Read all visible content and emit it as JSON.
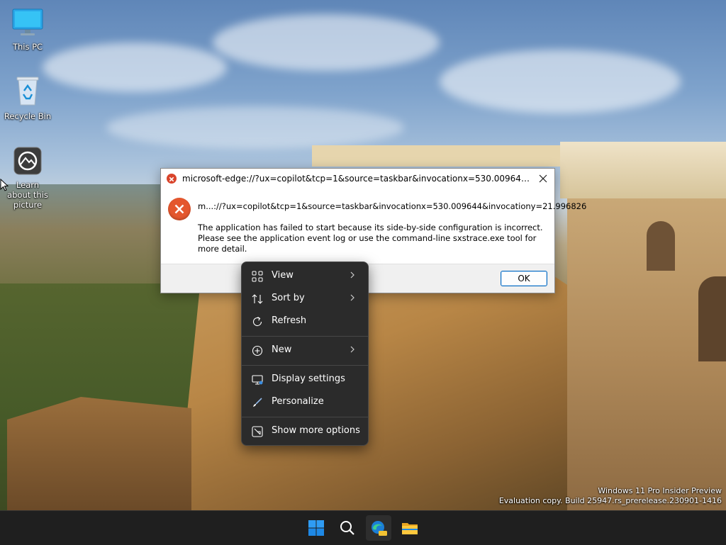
{
  "desktop": {
    "icons": [
      {
        "label": "This PC"
      },
      {
        "label": "Recycle Bin"
      },
      {
        "label": "Learn about this picture"
      }
    ]
  },
  "dialog": {
    "title": "microsoft-edge://?ux=copilot&tcp=1&source=taskbar&invocationx=530.009644&invocatio...",
    "path": "m...://?ux=copilot&tcp=1&source=taskbar&invocationx=530.009644&invocationy=21.996826",
    "message": "The application has failed to start because its side-by-side configuration is incorrect. Please see the application event log or use the command-line sxstrace.exe tool for more detail.",
    "ok_label": "OK"
  },
  "context_menu": {
    "items": [
      {
        "label": "View",
        "icon": "grid-icon",
        "submenu": true
      },
      {
        "label": "Sort by",
        "icon": "sort-icon",
        "submenu": true
      },
      {
        "label": "Refresh",
        "icon": "refresh-icon",
        "submenu": false
      },
      {
        "label": "New",
        "icon": "plus-circle-icon",
        "submenu": true
      },
      {
        "label": "Display settings",
        "icon": "monitor-icon",
        "submenu": false
      },
      {
        "label": "Personalize",
        "icon": "brush-icon",
        "submenu": false
      },
      {
        "label": "Show more options",
        "icon": "more-options-icon",
        "submenu": false
      }
    ]
  },
  "watermark": {
    "line1": "Windows 11 Pro Insider Preview",
    "line2": "Evaluation copy. Build 25947.rs_prerelease.230901-1416"
  },
  "taskbar": {
    "items": [
      {
        "name": "start-button",
        "icon": "windows-logo-icon"
      },
      {
        "name": "search-button",
        "icon": "search-icon"
      },
      {
        "name": "edge-pre-button",
        "icon": "edge-pre-icon"
      },
      {
        "name": "file-explorer-button",
        "icon": "folder-icon"
      }
    ]
  },
  "colors": {
    "menu_bg": "#2b2b2b",
    "taskbar_bg": "#1f1f1f",
    "error_red": "#e4572e",
    "accent_blue": "#0067c0"
  }
}
